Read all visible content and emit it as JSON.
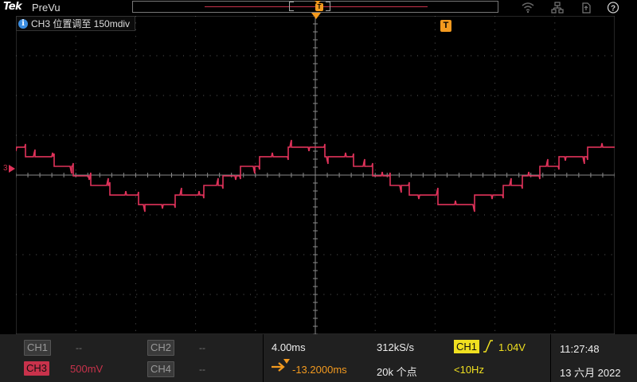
{
  "app": {
    "brand": "Tek",
    "mode": "PreVu"
  },
  "info_message": "CH3 位置调至 150mdiv",
  "channel_marker": "3",
  "channels": {
    "ch1": {
      "label": "CH1",
      "value": "--"
    },
    "ch2": {
      "label": "CH2",
      "value": "--"
    },
    "ch3": {
      "label": "CH3",
      "value": "500mV"
    },
    "ch4": {
      "label": "CH4",
      "value": "--"
    }
  },
  "horizontal": {
    "scale": "4.00ms",
    "position": "-13.2000ms",
    "sample_rate": "312kS/s",
    "record_length": "20k 个点"
  },
  "trigger": {
    "source": "CH1",
    "level": "1.04V",
    "frequency": "<10Hz",
    "marker": "T"
  },
  "clock": {
    "time": "11:27:48",
    "date": "13 六月 2022"
  },
  "colors": {
    "ch3": "#c8324b",
    "ch1": "#f0e020",
    "trigger": "#f39a1f",
    "grid": "#5a5a5a"
  },
  "icons": [
    "wifi-icon",
    "network-icon",
    "usb-icon",
    "help-icon"
  ],
  "waveform": {
    "period_ms": 20,
    "amplitude_div": 0.9,
    "levels": 7,
    "x_range_ms": [
      -20,
      20
    ]
  }
}
